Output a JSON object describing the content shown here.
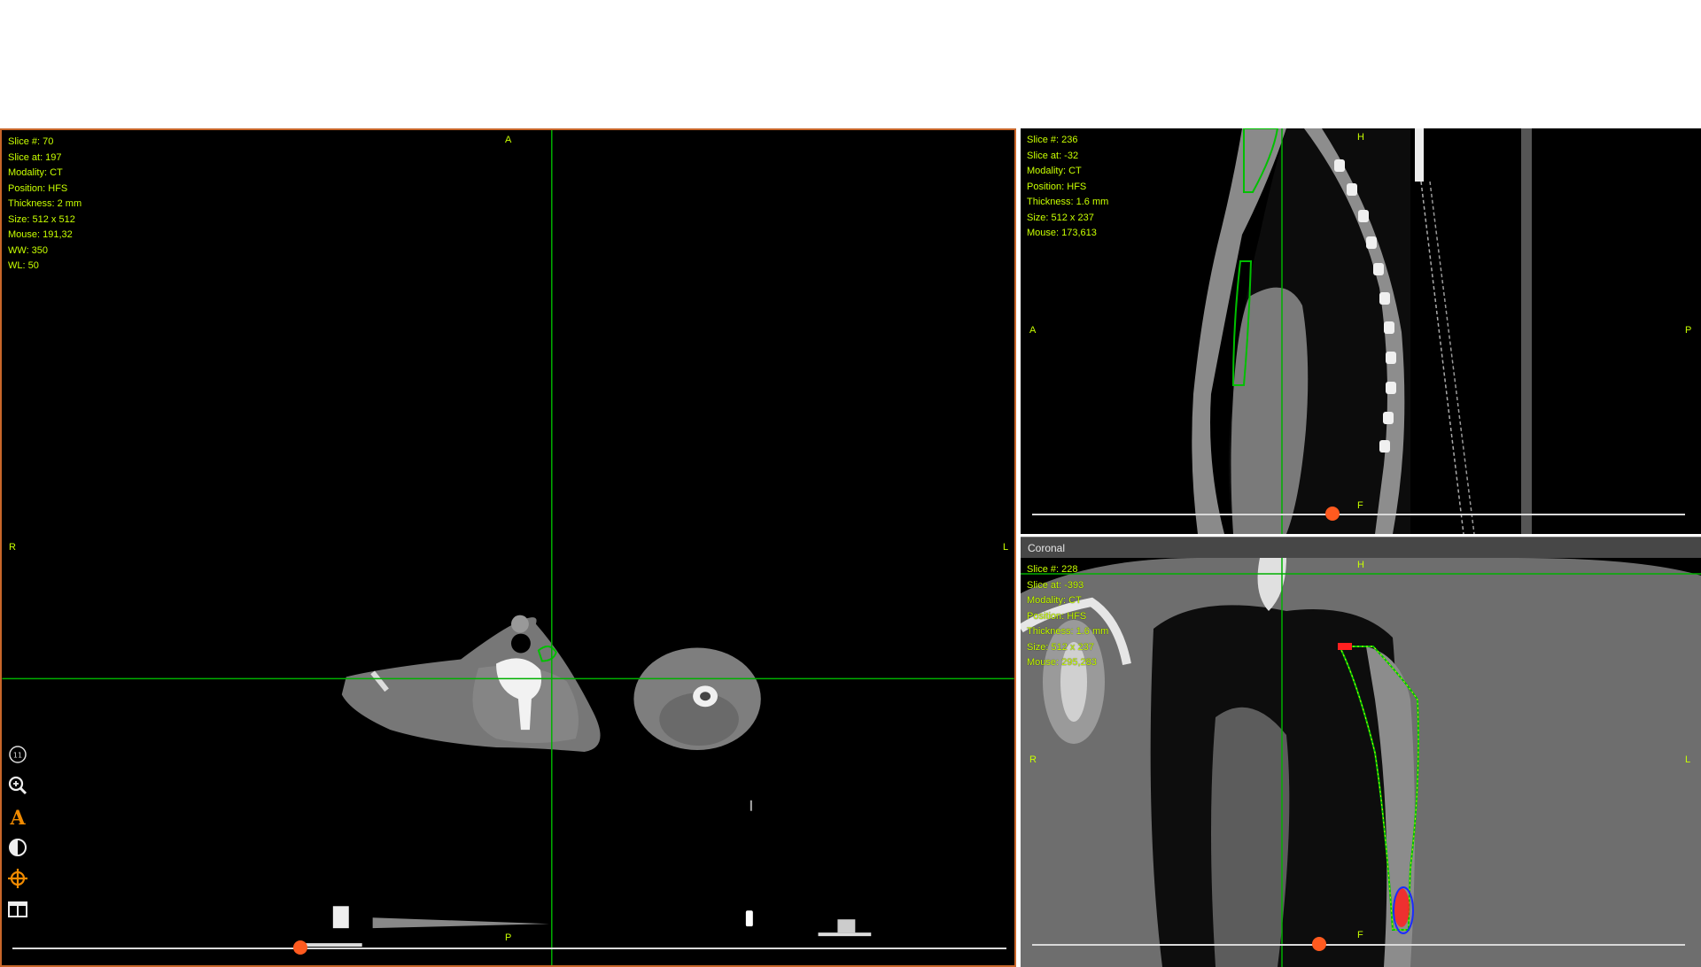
{
  "axial": {
    "info": [
      "Slice #: 70",
      "Slice at: 197",
      "Modality: CT",
      "Position: HFS",
      "Thickness: 2 mm",
      "Size: 512 x 512",
      "Mouse: 191,32",
      "WW: 350",
      "WL: 50"
    ],
    "orient": {
      "top": "A",
      "bottom": "P",
      "left": "R",
      "right": "L"
    },
    "slider_fraction": 0.29
  },
  "sagittal": {
    "info": [
      "Slice #: 236",
      "Slice at: -32",
      "Modality: CT",
      "Position: HFS",
      "Thickness: 1.6 mm",
      "Size: 512 x 237",
      "Mouse: 173,613"
    ],
    "orient": {
      "top": "H",
      "bottom": "F",
      "left": "A",
      "right": "P"
    },
    "slider_fraction": 0.46
  },
  "coronal": {
    "title": "Coronal",
    "info": [
      "Slice #: 228",
      "Slice at: -393",
      "Modality: CT",
      "Position: HFS",
      "Thickness: 1.6 mm",
      "Size: 512 x 237",
      "Mouse: 295,283"
    ],
    "orient": {
      "top": "H",
      "bottom": "F",
      "left": "R",
      "right": "L"
    },
    "slider_fraction": 0.44
  },
  "tools": [
    {
      "name": "slice-number-icon",
      "glyph": "11"
    },
    {
      "name": "zoom-icon",
      "glyph": "🔍"
    },
    {
      "name": "annotation-icon",
      "glyph": "A"
    },
    {
      "name": "window-level-icon",
      "glyph": "◐"
    },
    {
      "name": "crosshair-icon",
      "glyph": "⌖"
    },
    {
      "name": "layout-icon",
      "glyph": "◫"
    }
  ],
  "colors": {
    "info_text": "#c8ff00",
    "crosshair": "#00b000",
    "accent": "#ff5a1f",
    "border": "#c8662a"
  }
}
